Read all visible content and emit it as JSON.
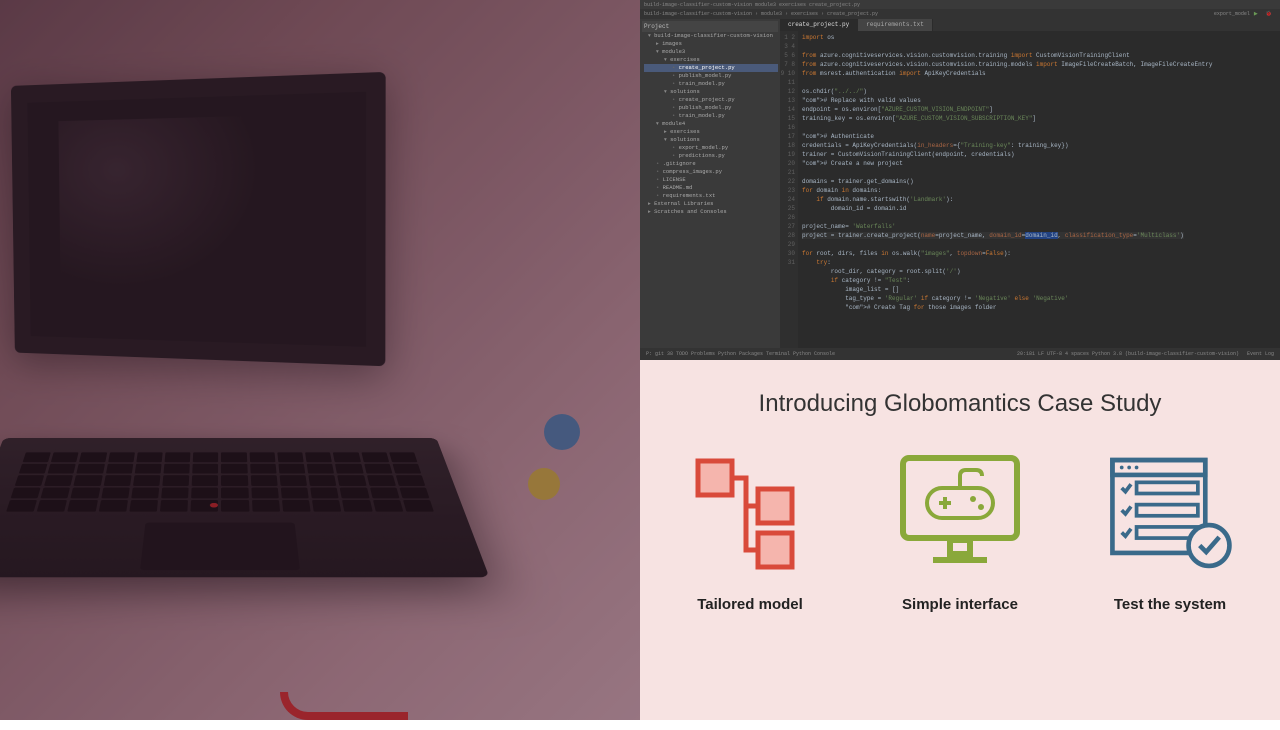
{
  "ide": {
    "titlebar": "build-image-classifier-custom-vision  module3  exercises  create_project.py",
    "toolbar": "build-image-classifier-custom-vision › module3 › exercises › create_project.py",
    "project_panel_title": "Project",
    "tree": [
      {
        "level": 0,
        "kind": "folder-open",
        "label": "build-image-classifier-custom-vision"
      },
      {
        "level": 1,
        "kind": "folder",
        "label": "images"
      },
      {
        "level": 1,
        "kind": "folder-open",
        "label": "module3"
      },
      {
        "level": 2,
        "kind": "folder-open",
        "label": "exercises"
      },
      {
        "level": 3,
        "kind": "file",
        "label": "create_project.py",
        "selected": true
      },
      {
        "level": 3,
        "kind": "file",
        "label": "publish_model.py"
      },
      {
        "level": 3,
        "kind": "file",
        "label": "train_model.py"
      },
      {
        "level": 2,
        "kind": "folder-open",
        "label": "solutions"
      },
      {
        "level": 3,
        "kind": "file",
        "label": "create_project.py"
      },
      {
        "level": 3,
        "kind": "file",
        "label": "publish_model.py"
      },
      {
        "level": 3,
        "kind": "file",
        "label": "train_model.py"
      },
      {
        "level": 1,
        "kind": "folder-open",
        "label": "module4"
      },
      {
        "level": 2,
        "kind": "folder",
        "label": "exercises"
      },
      {
        "level": 2,
        "kind": "folder-open",
        "label": "solutions"
      },
      {
        "level": 3,
        "kind": "file",
        "label": "export_model.py"
      },
      {
        "level": 3,
        "kind": "file",
        "label": "predictions.py"
      },
      {
        "level": 1,
        "kind": "file",
        "label": ".gitignore"
      },
      {
        "level": 1,
        "kind": "file",
        "label": "compress_images.py"
      },
      {
        "level": 1,
        "kind": "file",
        "label": "LICENSE"
      },
      {
        "level": 1,
        "kind": "file",
        "label": "README.md"
      },
      {
        "level": 1,
        "kind": "file",
        "label": "requirements.txt"
      },
      {
        "level": 0,
        "kind": "folder",
        "label": "External Libraries"
      },
      {
        "level": 0,
        "kind": "folder",
        "label": "Scratches and Consoles"
      }
    ],
    "tabs": [
      {
        "label": "create_project.py",
        "active": true
      },
      {
        "label": "requirements.txt",
        "active": false
      }
    ],
    "run_target": "export_model",
    "code_lines": [
      "import os",
      "",
      "from azure.cognitiveservices.vision.customvision.training import CustomVisionTrainingClient",
      "from azure.cognitiveservices.vision.customvision.training.models import ImageFileCreateBatch, ImageFileCreateEntry",
      "from msrest.authentication import ApiKeyCredentials",
      "",
      "os.chdir(\"../../\")",
      "# Replace with valid values",
      "endpoint = os.environ[\"AZURE_CUSTOM_VISION_ENDPOINT\"]",
      "training_key = os.environ[\"AZURE_CUSTOM_VISION_SUBSCRIPTION_KEY\"]",
      "",
      "# Authenticate",
      "credentials = ApiKeyCredentials(in_headers={\"Training-key\": training_key})",
      "trainer = CustomVisionTrainingClient(endpoint, credentials)",
      "# Create a new project",
      "",
      "domains = trainer.get_domains()",
      "for domain in domains:",
      "    if domain.name.startswith('Landmark'):",
      "        domain_id = domain.id",
      "",
      "project_name= 'Waterfalls'",
      "project = trainer.create_project(name=project_name, domain_id=domain_id, classification_type='Multiclass')",
      "",
      "for root, dirs, files in os.walk(\"images\", topdown=False):",
      "    try:",
      "        root_dir, category = root.split('/')",
      "        if category != \"Test\":",
      "            image_list = []",
      "            tag_type = 'Regular' if category != 'Negative' else 'Negative'",
      "            # Create Tag for those images folder"
    ],
    "status_left": "P: git   38 TODO   Problems   Python Packages   Terminal   Python Console",
    "status_right": [
      "20:181",
      "LF",
      "UTF-8",
      "4 spaces",
      "Python 3.8 (build-image-classifier-custom-vision)"
    ],
    "status_event": "Event Log"
  },
  "slide": {
    "title": "Introducing Globomantics Case Study",
    "items": [
      {
        "label": "Tailored model",
        "icon": "network"
      },
      {
        "label": "Simple interface",
        "icon": "monitor"
      },
      {
        "label": "Test the system",
        "icon": "checklist"
      }
    ]
  }
}
